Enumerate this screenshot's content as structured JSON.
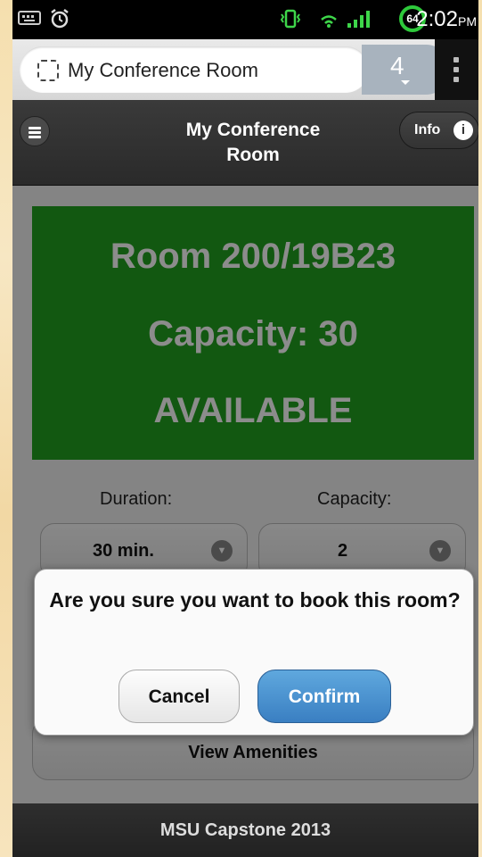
{
  "status_bar": {
    "time": "2:02",
    "ampm": "PM",
    "battery_level": "64",
    "icons": [
      "keyboard-icon",
      "alarm-icon",
      "vibrate-icon",
      "wifi-icon",
      "signal-icon"
    ]
  },
  "browser": {
    "url_title": "My Conference Room",
    "tab_count": "4"
  },
  "header": {
    "title_line1": "My Conference",
    "title_line2": "Room",
    "info_label": "Info",
    "info_icon_glyph": "i"
  },
  "room": {
    "name": "Room 200/19B23",
    "capacity": "Capacity: 30",
    "status": "AVAILABLE",
    "status_color": "#22a020"
  },
  "form": {
    "duration_label": "Duration:",
    "duration_value": "30 min.",
    "capacity_label": "Capacity:",
    "capacity_value": "2"
  },
  "amenities_button": "View Amenities",
  "dialog": {
    "message": "Are you sure you want to book this room?",
    "cancel_label": "Cancel",
    "confirm_label": "Confirm",
    "confirm_color": "#3a7fc2"
  },
  "footer": {
    "text": "MSU Capstone 2013"
  }
}
